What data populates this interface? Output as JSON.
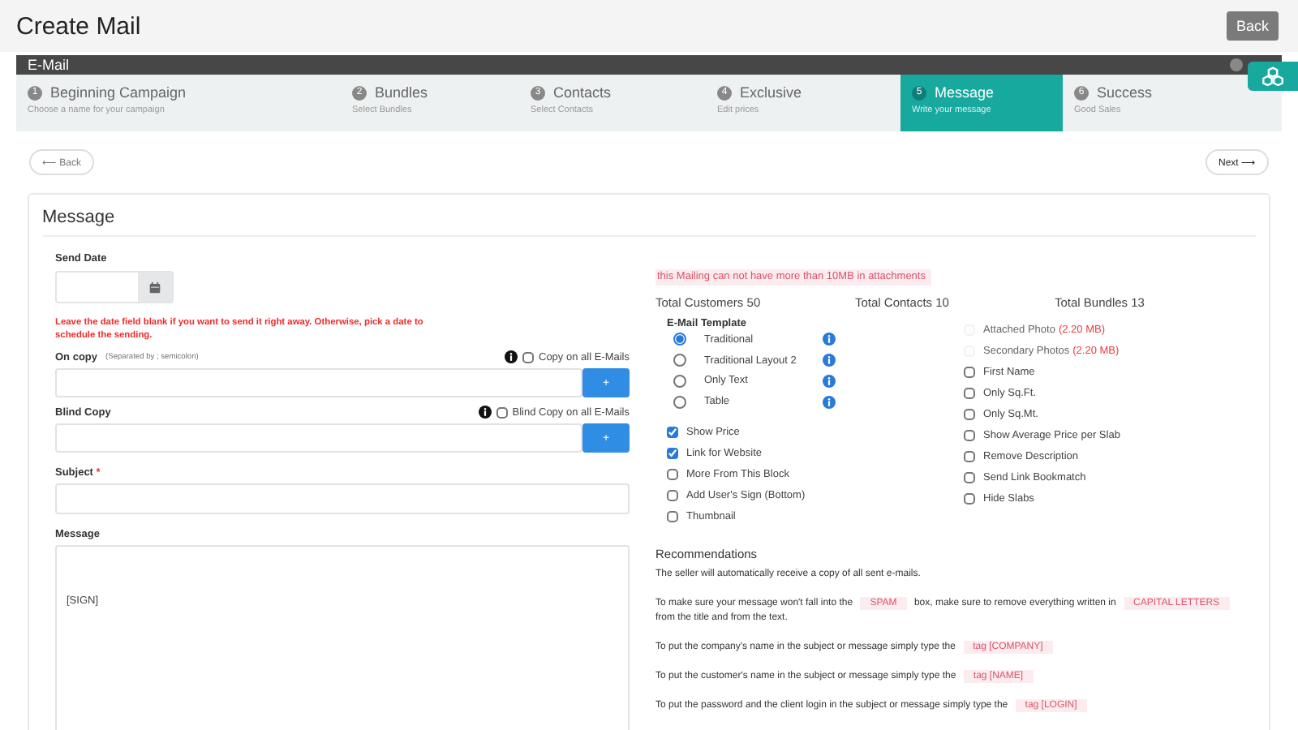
{
  "page_title": "Create Mail",
  "back_button": "Back",
  "panel": {
    "title": "E-Mail"
  },
  "steps": [
    {
      "number": "1",
      "title": "Beginning Campaign",
      "subtitle": "Choose a name for your campaign",
      "selected": false
    },
    {
      "number": "2",
      "title": "Bundles",
      "subtitle": "Select Bundles",
      "selected": false
    },
    {
      "number": "3",
      "title": "Contacts",
      "subtitle": "Select Contacts",
      "selected": false
    },
    {
      "number": "4",
      "title": "Exclusive",
      "subtitle": "Edit prices",
      "selected": false
    },
    {
      "number": "5",
      "title": "Message",
      "subtitle": "Write your message",
      "selected": true
    },
    {
      "number": "6",
      "title": "Success",
      "subtitle": "Good Sales",
      "selected": false
    }
  ],
  "nav": {
    "back": "⟵ Back",
    "next": "Next ⟶"
  },
  "form": {
    "title": "Message",
    "send_date": {
      "label": "Send Date"
    },
    "date_hint": "Leave the date field blank if you want to send it right away. Otherwise, pick a date to schedule the sending.",
    "copy_fields": [
      {
        "label": "On copy",
        "note": "(Separated by ; semicolon)",
        "checkbox": {
          "label": "Copy on all E-Mails",
          "checked": false
        },
        "add_button": "+"
      },
      {
        "label": "Blind Copy",
        "checkbox": {
          "label": "Blind Copy on all E-Mails",
          "checked": false
        },
        "add_button": "+"
      }
    ],
    "subject": {
      "label": "Subject",
      "required_mark": "*"
    },
    "message": {
      "label": "Message",
      "value": "[SIGN]"
    }
  },
  "options": {
    "alert": "this Mailing can not have more than 10MB in attachments",
    "totals": [
      "Total Customers 50",
      "Total Contacts 10",
      "Total Bundles 13"
    ],
    "template": {
      "label": "E-Mail Template",
      "choices": [
        {
          "label": "Traditional",
          "selected": true
        },
        {
          "label": "Traditional Layout 2",
          "selected": false
        },
        {
          "label": "Only Text",
          "selected": false
        },
        {
          "label": "Table",
          "selected": false
        }
      ]
    },
    "left_checks": [
      {
        "label": "Show Price",
        "checked": true
      },
      {
        "label": "Link for Website",
        "checked": true
      },
      {
        "label": "More From This Block",
        "checked": false
      },
      {
        "label": "Add User's Sign (Bottom)",
        "checked": false
      },
      {
        "label": "Thumbnail",
        "checked": false
      }
    ],
    "right_checks": [
      {
        "label": "Attached Photo",
        "size": "(2.20 MB)",
        "checked": false,
        "disabled": true
      },
      {
        "label": "Secondary Photos",
        "size": "(2.20 MB)",
        "checked": false,
        "disabled": true
      },
      {
        "label": "First Name",
        "checked": false,
        "disabled": false
      },
      {
        "label": "Only Sq.Ft.",
        "checked": false,
        "disabled": false
      },
      {
        "label": "Only Sq.Mt.",
        "checked": false,
        "disabled": false
      },
      {
        "label": "Show Average Price per Slab",
        "checked": false,
        "disabled": false
      },
      {
        "label": "Remove Description",
        "checked": false,
        "disabled": false
      },
      {
        "label": "Send Link Bookmatch",
        "checked": false,
        "disabled": false
      },
      {
        "label": "Hide Slabs",
        "checked": false,
        "disabled": false
      }
    ]
  },
  "recommendations": {
    "title": "Recommendations",
    "paragraphs": [
      [
        {
          "kind": "text",
          "text": "The seller will automatically receive a copy of all sent e-mails."
        }
      ],
      [
        {
          "kind": "text",
          "text": "To make sure your message won't fall into the "
        },
        {
          "kind": "tag",
          "text": "SPAM"
        },
        {
          "kind": "text",
          "text": " box, make sure to remove everything written in "
        },
        {
          "kind": "tag",
          "text": "CAPITAL LETTERS"
        },
        {
          "kind": "text",
          "text": " from the title and from the text."
        }
      ],
      [
        {
          "kind": "text",
          "text": "To put the company's name in the subject or message simply type the "
        },
        {
          "kind": "tag",
          "text": "tag [COMPANY]"
        }
      ],
      [
        {
          "kind": "text",
          "text": "To put the customer's name in the subject or message simply type the "
        },
        {
          "kind": "tag",
          "text": "tag [NAME]"
        }
      ],
      [
        {
          "kind": "text",
          "text": "To put the password and the client login in the subject or message simply type the "
        },
        {
          "kind": "tag",
          "text": "tag [LOGIN]"
        }
      ]
    ]
  }
}
